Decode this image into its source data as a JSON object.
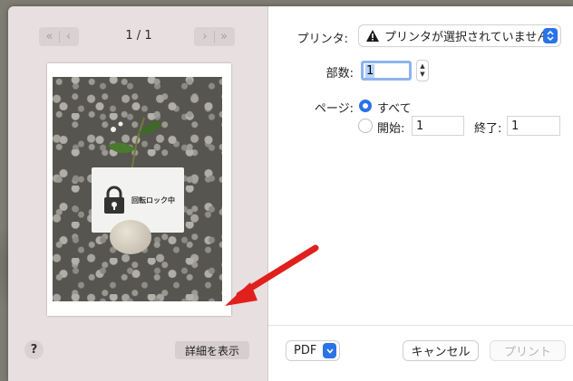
{
  "preview": {
    "page_indicator": "1 / 1",
    "first_page_icon": "double-chevron-left-icon",
    "prev_page_icon": "chevron-left-icon",
    "next_page_icon": "chevron-right-icon",
    "last_page_icon": "double-chevron-right-icon",
    "photo_card_text": "回転ロック中",
    "details_label": "詳細を表示",
    "help_label": "?"
  },
  "settings": {
    "printer_label": "プリンタ:",
    "printer_value": "プリンタが選択されていません",
    "copies_label": "部数:",
    "copies_value": "1",
    "pages_label": "ページ:",
    "pages_all_label": "すべて",
    "pages_from_label": "開始:",
    "pages_from_value": "1",
    "pages_to_label": "終了:",
    "pages_to_value": "1"
  },
  "footer": {
    "pdf_label": "PDF",
    "cancel_label": "キャンセル",
    "print_label": "プリント"
  },
  "colors": {
    "accent": "#2a73e8",
    "arrow": "#e0201c",
    "sidebar_bg": "#e7dfe0"
  }
}
